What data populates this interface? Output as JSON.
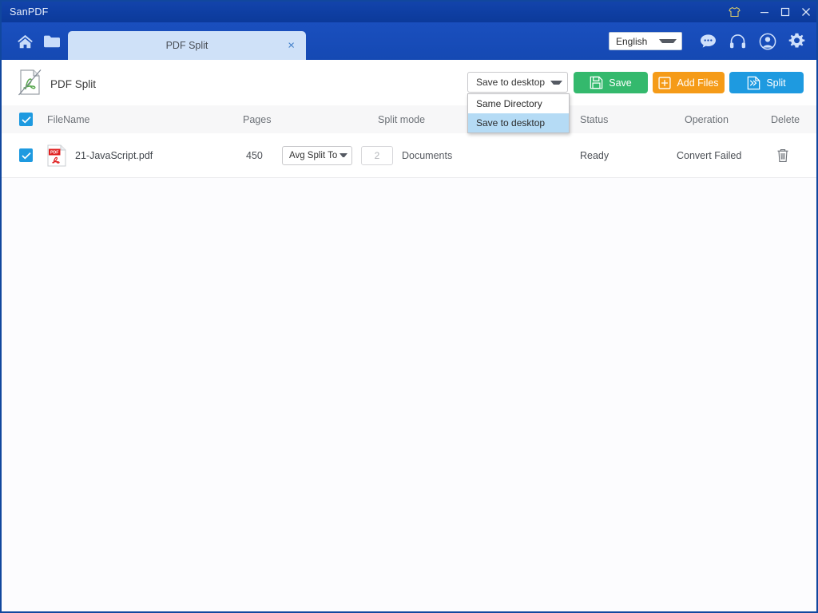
{
  "window": {
    "app_title": "SanPDF",
    "controls": {
      "skin": "tshirt-icon",
      "minimize": "minimize-icon",
      "maximize": "maximize-icon",
      "close": "close-icon"
    }
  },
  "toolbar": {
    "home_icon": "home-icon",
    "folder_icon": "folder-icon",
    "tab": {
      "label": "PDF Split",
      "close": "×"
    },
    "language": {
      "selected": "English",
      "options": [
        "English"
      ]
    },
    "right_icons": [
      "chat-icon",
      "headset-icon",
      "account-icon",
      "settings-icon"
    ]
  },
  "actionbar": {
    "page_title": "PDF Split",
    "page_icon": "pdf-split-icon",
    "save_to": {
      "selected": "Save to desktop",
      "open": true,
      "options": [
        "Same Directory",
        "Save to desktop"
      ]
    },
    "buttons": {
      "save_label": "Save",
      "add_files_label": "Add Files",
      "split_label": "Split"
    },
    "colors": {
      "save": "#34b96d",
      "add_files": "#f59b18",
      "split": "#1e9ae0",
      "accent": "#1e9ae0",
      "titlebar": "#0e3ea2",
      "toolbar": "#1549b3",
      "tab": "#cfe1f8",
      "dropdown_highlight": "#b5dbf5"
    }
  },
  "table": {
    "columns": [
      "FileName",
      "Pages",
      "Split mode",
      "Status",
      "Operation",
      "Delete"
    ],
    "header_checkbox_checked": true,
    "rows": [
      {
        "checked": true,
        "file_icon": "pdf-file-icon",
        "filename": "21-JavaScript.pdf",
        "pages": "450",
        "split_mode": "Avg Split To",
        "split_count": "2",
        "split_unit": "Documents",
        "status": "Ready",
        "operation": "Convert Failed",
        "delete_icon": "trash-icon"
      }
    ]
  }
}
